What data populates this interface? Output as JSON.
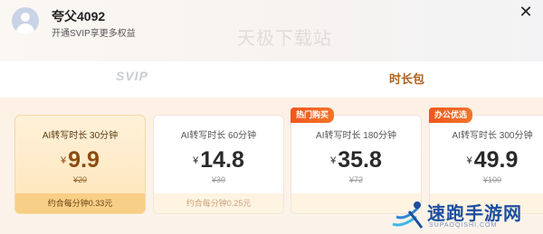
{
  "header": {
    "username": "夸父4092",
    "subtitle": "开通SVIP享更多权益",
    "watermark": "天极下载站",
    "close_icon": "close-icon"
  },
  "tabs": [
    {
      "label": "SVIP",
      "active": false
    },
    {
      "label": "时长包",
      "active": true
    }
  ],
  "plans": [
    {
      "title": "AI转写时长 30分钟",
      "currency": "¥",
      "price": "9.9",
      "original": "¥20",
      "per_minute": "约合每分钟0.33元",
      "badge": "",
      "selected": true
    },
    {
      "title": "AI转写时长 60分钟",
      "currency": "¥",
      "price": "14.8",
      "original": "¥30",
      "per_minute": "约合每分钟0.25元",
      "badge": "",
      "selected": false
    },
    {
      "title": "AI转写时长 180分钟",
      "currency": "¥",
      "price": "35.8",
      "original": "¥72",
      "per_minute": "",
      "badge": "热门购买",
      "selected": false
    },
    {
      "title": "AI转写时长 300分钟",
      "currency": "¥",
      "price": "49.9",
      "original": "¥100",
      "per_minute": "",
      "badge": "办公优选",
      "selected": false
    }
  ],
  "site_watermark": {
    "name": "速跑手游网",
    "sub": "SUPAOQISHI.COM"
  },
  "colors": {
    "accent": "#b0611c",
    "badge": "#f0571c",
    "selected_bg": "#fde5b9",
    "watermark_blue": "#1d4fa0"
  }
}
